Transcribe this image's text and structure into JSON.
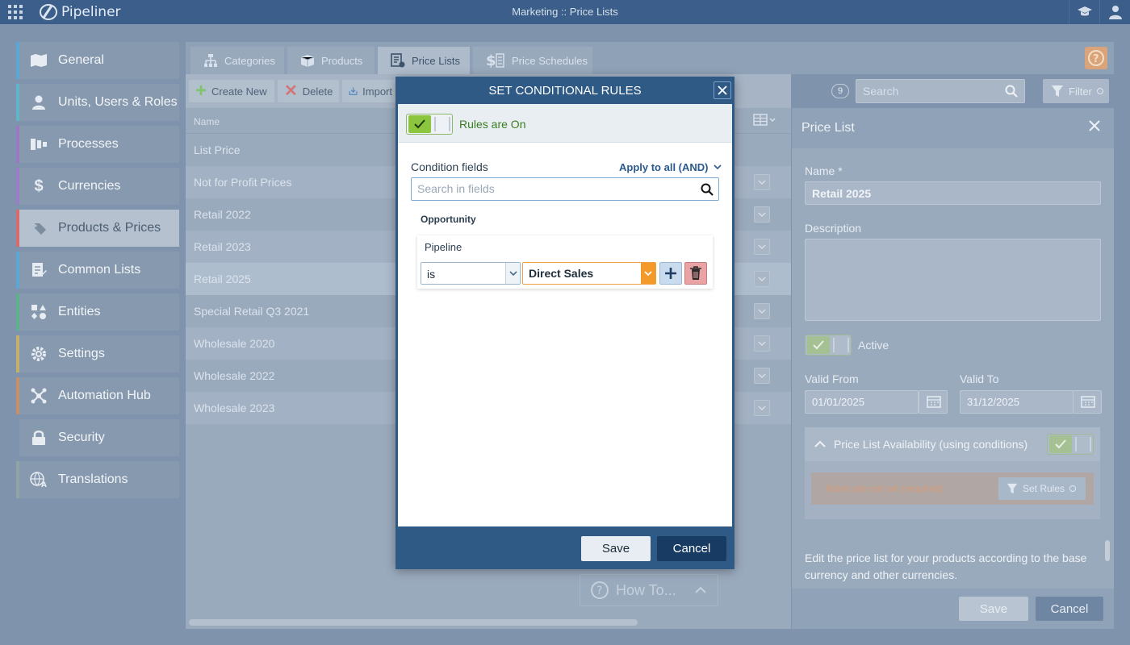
{
  "topbar": {
    "app_name": "Pipeliner",
    "title": "Marketing :: Price Lists"
  },
  "sidebar": {
    "items": [
      {
        "label": "General",
        "icon": "map-icon",
        "color": "#5aa7d6"
      },
      {
        "label": "Units, Users & Roles",
        "icon": "user-icon",
        "color": "#5fb6c4"
      },
      {
        "label": "Processes",
        "icon": "funnel-icon",
        "color": "#9b78c2"
      },
      {
        "label": "Currencies",
        "icon": "dollar-icon",
        "color": "#9a7cc7"
      },
      {
        "label": "Products & Prices",
        "icon": "tag-icon",
        "color": "#d66b6b"
      },
      {
        "label": "Common Lists",
        "icon": "list-edit-icon",
        "color": "#5aa7d6"
      },
      {
        "label": "Entities",
        "icon": "shapes-icon",
        "color": "#5fb08c"
      },
      {
        "label": "Settings",
        "icon": "gear-icon",
        "color": "#c3b06a"
      },
      {
        "label": "Automation Hub",
        "icon": "nodes-icon",
        "color": "#c48f6a"
      },
      {
        "label": "Security",
        "icon": "lock-icon",
        "color": "#7e93b1"
      },
      {
        "label": "Translations",
        "icon": "translate-icon",
        "color": "#8ea5a1"
      }
    ]
  },
  "tabs": [
    {
      "label": "Categories",
      "icon": "hierarchy-icon"
    },
    {
      "label": "Products",
      "icon": "box-icon"
    },
    {
      "label": "Price Lists",
      "icon": "price-list-icon"
    },
    {
      "label": "Price Schedules",
      "icon": "price-schedule-icon"
    }
  ],
  "toolbar": {
    "create_new": "Create New",
    "delete": "Delete",
    "import": "Import",
    "count": "9",
    "search_placeholder": "Search",
    "filter": "Filter"
  },
  "list": {
    "column_name": "Name",
    "rows": [
      "List Price",
      "Not for Profit Prices",
      "Retail 2022",
      "Retail 2023",
      "Retail 2025",
      "Special Retail Q3 2021",
      "Wholesale 2020",
      "Wholesale 2022",
      "Wholesale 2023"
    ],
    "selected_index": 4
  },
  "howto": {
    "label": "How To..."
  },
  "detail": {
    "title": "Price List",
    "name_label": "Name *",
    "name_value": "Retail 2025",
    "description_label": "Description",
    "active_label": "Active",
    "valid_from_label": "Valid From",
    "valid_from_value": "01/01/2025",
    "valid_to_label": "Valid To",
    "valid_to_value": "31/12/2025",
    "availability_label": "Price List Availability (using conditions)",
    "rules_not_set": "Rules are not set (required)",
    "set_rules": "Set Rules",
    "info_text": "Edit the price list for your products according to the base currency and other currencies.",
    "save": "Save",
    "cancel": "Cancel"
  },
  "modal": {
    "title": "SET CONDITIONAL RULES",
    "rules_on": "Rules are On",
    "condition_fields": "Condition fields",
    "apply_all": "Apply to all (AND)",
    "search_placeholder": "Search in fields",
    "group": "Opportunity",
    "field": "Pipeline",
    "operator": "is",
    "value": "Direct Sales",
    "save": "Save",
    "cancel": "Cancel"
  }
}
